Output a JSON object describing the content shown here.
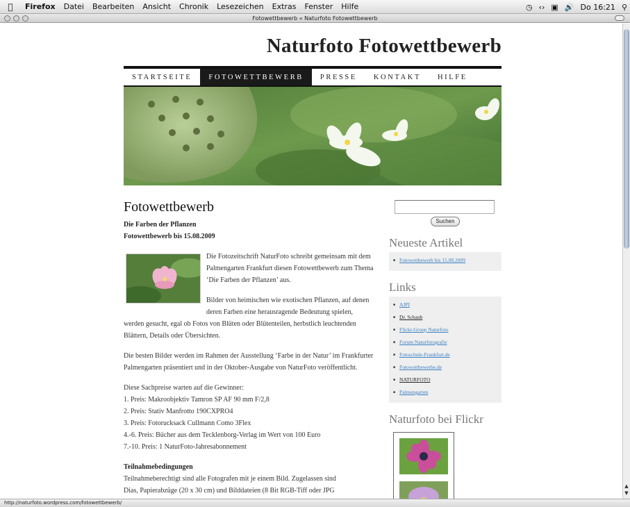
{
  "menubar": {
    "apple": "",
    "app_name": "Firefox",
    "items": [
      "Datei",
      "Bearbeiten",
      "Ansicht",
      "Chronik",
      "Lesezeichen",
      "Extras",
      "Fenster",
      "Hilfe"
    ],
    "clock": "Do 16:21"
  },
  "window": {
    "title": "Fotowettbewerb « Naturfoto Fotowettbewerb"
  },
  "site": {
    "title": "Naturfoto Fotowettbewerb",
    "nav": [
      "STARTSEITE",
      "FOTOWETTBEWERB",
      "PRESSE",
      "KONTAKT",
      "HILFE"
    ],
    "active_nav": "FOTOWETTBEWERB"
  },
  "post": {
    "title": "Fotowettbewerb",
    "subtitle1": "Die Farben der Pflanzen",
    "subtitle2": "Fotowettbewerb bis 15.08.2009",
    "para1": "Die Fotozeitschrift NaturFoto schreibt gemeinsam mit dem Palmengarten Frankfurt diesen Fotowettbewerb zum Thema ‘Die Farben der Pflanzen’ aus.",
    "para2": "Bilder von heimischen wie exotischen Pflanzen, auf denen deren Farben eine herausragende Bedeutung spielen, werden gesucht, egal ob Fotos von Blüten oder Blütenteilen, herbstlich leuchtenden Blättern, Details oder Übersichten.",
    "para3": "Die besten Bilder werden im Rahmen der Ausstellung ‘Farbe in der Natur’ im Frankfurter Palmengarten präsentiert und in der Oktober-Ausgabe von NaturFoto veröffentlicht.",
    "prizes_intro": "Diese Sachpreise warten auf die Gewinner:",
    "prizes": [
      "1. Preis: Makroobjektiv Tamron SP AF 90 mm F/2,8",
      "2. Preis: Stativ Manfrotto 190CXPRO4",
      "3. Preis: Fotorucksack Cullmann Como 3Flex",
      "4.-6. Preis: Bücher aus dem Tecklenborg-Verlag im Wert von 100 Euro",
      "7.-10. Preis: 1 NaturFoto-Jahresabonnement"
    ],
    "conditions_title": "Teilnahmebedingungen",
    "conditions_line1": "Teilnahmeberechtigt sind alle Fotografen mit je einem Bild. Zugelassen sind",
    "conditions_line2": "Dias, Papierabzüge (20 x 30 cm) und Bilddateien (8 Bit RGB-Tiff oder JPG"
  },
  "sidebar": {
    "search_value": "",
    "search_button": "Suchen",
    "recent_title": "Neueste Artikel",
    "recent": [
      "Fotowettbewerb bis 15.08.2009"
    ],
    "links_title": "Links",
    "links": [
      "AJPI",
      "Dr. Schaub",
      "Flickr-Group Naturfoto",
      "Forum Naturfotografie",
      "Fotoschule-Frankfurt.de",
      "Fotowettbewerbe.de",
      "NATURFOTO",
      "Palmengarten"
    ],
    "flickr_title": "Naturfoto bei Flickr"
  },
  "status": {
    "url": "http://naturfoto.wordpress.com/fotowettbewerb/"
  },
  "colors": {
    "link": "#3a7fc1",
    "nav_active_bg": "#1a1a1a",
    "sidebar_box": "#efefef"
  }
}
